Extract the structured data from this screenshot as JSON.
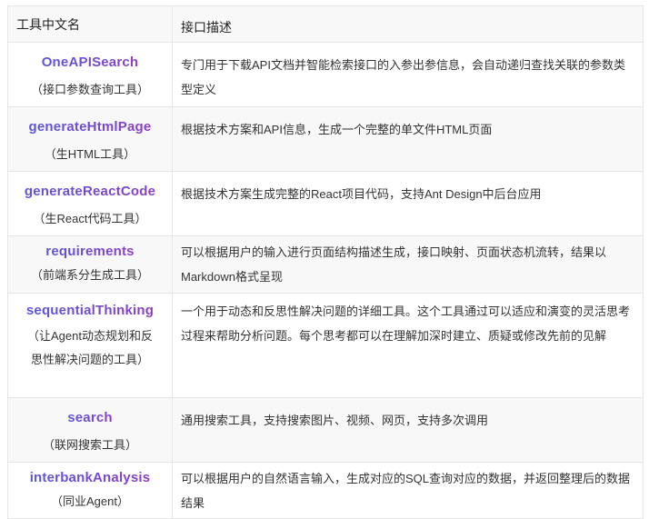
{
  "header": {
    "col1": "工具中文名",
    "col2": "接口描述"
  },
  "rows": [
    {
      "name": "OneAPISearch",
      "cn": "（接口参数查询工具）",
      "desc": "专门用于下载API文档并智能检索接口的入参出参信息，会自动递归查找关联的参数类型定义"
    },
    {
      "name": "generateHtmlPage",
      "cn": "（生HTML工具）",
      "desc": "根据技术方案和API信息，生成一个完整的单文件HTML页面"
    },
    {
      "name": "generateReactCode",
      "cn": "（生React代码工具）",
      "desc": "根据技术方案生成完整的React项目代码，支持Ant Design中后台应用"
    },
    {
      "name": "requirements",
      "cn": "（前端系分生成工具）",
      "desc": "可以根据用户的输入进行页面结构描述生成，接口映射、页面状态机流转，结果以Markdown格式呈现"
    },
    {
      "name": "sequentialThinking",
      "cn": "（让Agent动态规划和反思性解决问题的工具）",
      "desc": "一个用于动态和反思性解决问题的详细工具。这个工具通过可以适应和演变的灵活思考过程来帮助分析问题。每个思考都可以在理解加深时建立、质疑或修改先前的见解"
    },
    {
      "name": "search",
      "cn": "（联网搜索工具）",
      "desc": "通用搜索工具，支持搜索图片、视频、网页，支持多次调用"
    },
    {
      "name": "interbankAnalysis",
      "cn": "（同业Agent）",
      "desc": "可以根据用户的自然语言输入，生成对应的SQL查询对应的数据，并返回整理后的数据结果"
    }
  ]
}
